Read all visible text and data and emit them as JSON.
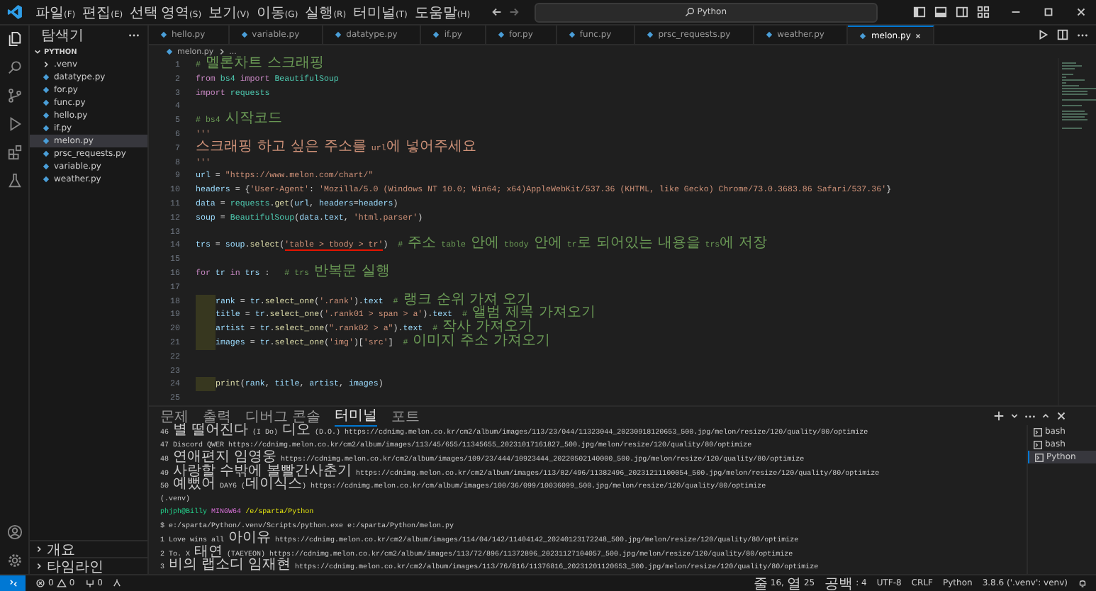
{
  "menu": [
    "파일(F)",
    "편집(E)",
    "선택 영역(S)",
    "보기(V)",
    "이동(G)",
    "실행(R)",
    "터미널(T)",
    "도움말(H)"
  ],
  "command_center": "Python",
  "explorer": {
    "title": "탐색기",
    "folder": "PYTHON",
    "items": [
      {
        "label": ".venv",
        "kind": "folder",
        "selected": false
      },
      {
        "label": "datatype.py",
        "kind": "file",
        "selected": false
      },
      {
        "label": "for.py",
        "kind": "file",
        "selected": false
      },
      {
        "label": "func.py",
        "kind": "file",
        "selected": false
      },
      {
        "label": "hello.py",
        "kind": "file",
        "selected": false
      },
      {
        "label": "if.py",
        "kind": "file",
        "selected": false
      },
      {
        "label": "melon.py",
        "kind": "file",
        "selected": true
      },
      {
        "label": "prsc_requests.py",
        "kind": "file",
        "selected": false
      },
      {
        "label": "variable.py",
        "kind": "file",
        "selected": false
      },
      {
        "label": "weather.py",
        "kind": "file",
        "selected": false
      }
    ],
    "sections": [
      "개요",
      "타임라인"
    ]
  },
  "tabs": [
    {
      "label": "hello.py",
      "selected": false
    },
    {
      "label": "variable.py",
      "selected": false
    },
    {
      "label": "datatype.py",
      "selected": false
    },
    {
      "label": "if.py",
      "selected": false
    },
    {
      "label": "for.py",
      "selected": false
    },
    {
      "label": "func.py",
      "selected": false
    },
    {
      "label": "prsc_requests.py",
      "selected": false
    },
    {
      "label": "weather.py",
      "selected": false
    },
    {
      "label": "melon.py",
      "selected": true
    }
  ],
  "breadcrumb": [
    "melon.py",
    "..."
  ],
  "code": [
    {
      "n": "1",
      "indented": false,
      "segs": [
        {
          "kind": "c",
          "text": "# 멜론차트 스크래핑"
        }
      ]
    },
    {
      "n": "2",
      "indented": false,
      "segs": [
        {
          "kind": "k",
          "text": "from "
        },
        {
          "kind": "t",
          "text": "bs4 "
        },
        {
          "kind": "k",
          "text": "import "
        },
        {
          "kind": "t",
          "text": "BeautifulSoup"
        }
      ]
    },
    {
      "n": "3",
      "indented": false,
      "segs": [
        {
          "kind": "k",
          "text": "import "
        },
        {
          "kind": "t",
          "text": "requests"
        }
      ]
    },
    {
      "n": "4",
      "indented": false
    },
    {
      "n": "5",
      "indented": false,
      "segs": [
        {
          "kind": "c",
          "text": "# bs4 시작코드"
        }
      ]
    },
    {
      "n": "6",
      "indented": false,
      "segs": [
        {
          "kind": "s",
          "text": "'''"
        }
      ]
    },
    {
      "n": "7",
      "indented": false,
      "segs": [
        {
          "kind": "s",
          "text": "스크래핑 하고 싶은 주소를 url에 넣어주세요"
        }
      ]
    },
    {
      "n": "8",
      "indented": false,
      "segs": [
        {
          "kind": "s",
          "text": "'''"
        }
      ]
    },
    {
      "n": "9",
      "indented": false,
      "segs": [
        {
          "kind": "v",
          "text": "url"
        },
        {
          "kind": "p",
          "text": " = "
        },
        {
          "kind": "s",
          "text": "\"https://www.melon.com/chart/\""
        }
      ]
    },
    {
      "n": "10",
      "indented": false,
      "segs": [
        {
          "kind": "v",
          "text": "headers"
        },
        {
          "kind": "p",
          "text": " = {"
        },
        {
          "kind": "s",
          "text": "'User-Agent'"
        },
        {
          "kind": "p",
          "text": ": "
        },
        {
          "kind": "s",
          "text": "'Mozilla/5.0 (Windows NT 10.0; Win64; x64)AppleWebKit/537.36 (KHTML, like Gecko) Chrome/73.0.3683.86 Safari/537.36'"
        },
        {
          "kind": "p",
          "text": "}"
        }
      ]
    },
    {
      "n": "11",
      "indented": false,
      "segs": [
        {
          "kind": "v",
          "text": "data"
        },
        {
          "kind": "p",
          "text": " = "
        },
        {
          "kind": "t",
          "text": "requests"
        },
        {
          "kind": "p",
          "text": "."
        },
        {
          "kind": "f",
          "text": "get"
        },
        {
          "kind": "p",
          "text": "("
        },
        {
          "kind": "v",
          "text": "url"
        },
        {
          "kind": "p",
          "text": ", "
        },
        {
          "kind": "v",
          "text": "headers"
        },
        {
          "kind": "p",
          "text": "="
        },
        {
          "kind": "v",
          "text": "headers"
        },
        {
          "kind": "p",
          "text": ")"
        }
      ]
    },
    {
      "n": "12",
      "indented": false,
      "segs": [
        {
          "kind": "v",
          "text": "soup"
        },
        {
          "kind": "p",
          "text": " = "
        },
        {
          "kind": "t",
          "text": "BeautifulSoup"
        },
        {
          "kind": "p",
          "text": "("
        },
        {
          "kind": "v",
          "text": "data"
        },
        {
          "kind": "p",
          "text": "."
        },
        {
          "kind": "v",
          "text": "text"
        },
        {
          "kind": "p",
          "text": ", "
        },
        {
          "kind": "s",
          "text": "'html.parser'"
        },
        {
          "kind": "p",
          "text": ")"
        }
      ]
    },
    {
      "n": "13",
      "indented": false
    },
    {
      "n": "14",
      "indented": false,
      "segs": [
        {
          "kind": "v",
          "text": "trs"
        },
        {
          "kind": "p",
          "text": " = "
        },
        {
          "kind": "v",
          "text": "soup"
        },
        {
          "kind": "p",
          "text": "."
        },
        {
          "kind": "f",
          "text": "select"
        },
        {
          "kind": "p",
          "text": "("
        },
        {
          "kind": "m",
          "text": "'table > tbody > tr'"
        },
        {
          "kind": "p",
          "text": ")"
        },
        {
          "kind": "c",
          "text": "  # 주소 table 안에 tbody 안에 tr로 되어있는 내용을 trs에 저장"
        }
      ]
    },
    {
      "n": "15",
      "indented": false
    },
    {
      "n": "16",
      "indented": false,
      "segs": [
        {
          "kind": "k",
          "text": "for "
        },
        {
          "kind": "v",
          "text": "tr "
        },
        {
          "kind": "k",
          "text": "in "
        },
        {
          "kind": "v",
          "text": "trs"
        },
        {
          "kind": "p",
          "text": " :"
        },
        {
          "kind": "c",
          "text": "   # trs 반복문 실행"
        }
      ]
    },
    {
      "n": "17",
      "indented": false
    },
    {
      "n": "18",
      "indented": true,
      "segs": [
        {
          "kind": "v",
          "text": "rank"
        },
        {
          "kind": "p",
          "text": " = "
        },
        {
          "kind": "v",
          "text": "tr"
        },
        {
          "kind": "p",
          "text": "."
        },
        {
          "kind": "f",
          "text": "select_one"
        },
        {
          "kind": "p",
          "text": "("
        },
        {
          "kind": "s",
          "text": "'.rank'"
        },
        {
          "kind": "p",
          "text": ")."
        },
        {
          "kind": "v",
          "text": "text"
        },
        {
          "kind": "c",
          "text": "  # 랭크 순위 가져 오기"
        }
      ]
    },
    {
      "n": "19",
      "indented": true,
      "segs": [
        {
          "kind": "v",
          "text": "title"
        },
        {
          "kind": "p",
          "text": " = "
        },
        {
          "kind": "v",
          "text": "tr"
        },
        {
          "kind": "p",
          "text": "."
        },
        {
          "kind": "f",
          "text": "select_one"
        },
        {
          "kind": "p",
          "text": "("
        },
        {
          "kind": "s",
          "text": "'.rank01 > span > a'"
        },
        {
          "kind": "p",
          "text": ")."
        },
        {
          "kind": "v",
          "text": "text"
        },
        {
          "kind": "c",
          "text": "  # 앨범 제목 가져오기"
        }
      ]
    },
    {
      "n": "20",
      "indented": true,
      "segs": [
        {
          "kind": "v",
          "text": "artist"
        },
        {
          "kind": "p",
          "text": " = "
        },
        {
          "kind": "v",
          "text": "tr"
        },
        {
          "kind": "p",
          "text": "."
        },
        {
          "kind": "f",
          "text": "select_one"
        },
        {
          "kind": "p",
          "text": "("
        },
        {
          "kind": "s",
          "text": "\".rank02 > a\""
        },
        {
          "kind": "p",
          "text": ")."
        },
        {
          "kind": "v",
          "text": "text"
        },
        {
          "kind": "c",
          "text": "  # 작사 가져오기"
        }
      ]
    },
    {
      "n": "21",
      "indented": true,
      "segs": [
        {
          "kind": "v",
          "text": "images"
        },
        {
          "kind": "p",
          "text": " = "
        },
        {
          "kind": "v",
          "text": "tr"
        },
        {
          "kind": "p",
          "text": "."
        },
        {
          "kind": "f",
          "text": "select_one"
        },
        {
          "kind": "p",
          "text": "("
        },
        {
          "kind": "s",
          "text": "'img'"
        },
        {
          "kind": "p",
          "text": ")["
        },
        {
          "kind": "s",
          "text": "'src'"
        },
        {
          "kind": "p",
          "text": "]"
        },
        {
          "kind": "c",
          "text": "  # 이미지 주소 가져오기"
        }
      ]
    },
    {
      "n": "22",
      "indented": false
    },
    {
      "n": "23",
      "indented": false
    },
    {
      "n": "24",
      "indented": true,
      "segs": [
        {
          "kind": "f",
          "text": "print"
        },
        {
          "kind": "p",
          "text": "("
        },
        {
          "kind": "v",
          "text": "rank"
        },
        {
          "kind": "p",
          "text": ", "
        },
        {
          "kind": "v",
          "text": "title"
        },
        {
          "kind": "p",
          "text": ", "
        },
        {
          "kind": "v",
          "text": "artist"
        },
        {
          "kind": "p",
          "text": ", "
        },
        {
          "kind": "v",
          "text": "images"
        },
        {
          "kind": "p",
          "text": ")"
        }
      ]
    },
    {
      "n": "25",
      "indented": false
    }
  ],
  "panel_tabs": [
    {
      "label": "문제",
      "selected": false
    },
    {
      "label": "출력",
      "selected": false
    },
    {
      "label": "디버그 콘솔",
      "selected": false
    },
    {
      "label": "터미널",
      "selected": true
    },
    {
      "label": "포트",
      "selected": false
    }
  ],
  "terminal": [
    {
      "kind": "out",
      "text": "46 별 떨어진다 (I Do) 디오 (D.O.) https://cdnimg.melon.co.kr/cm2/album/images/113/23/044/11323044_20230918120653_500.jpg/melon/resize/120/quality/80/optimize"
    },
    {
      "kind": "out",
      "text": "47 Discord QWER https://cdnimg.melon.co.kr/cm2/album/images/113/45/655/11345655_20231017161827_500.jpg/melon/resize/120/quality/80/optimize"
    },
    {
      "kind": "out",
      "text": "48 연애편지 임영웅 https://cdnimg.melon.co.kr/cm2/album/images/109/23/444/10923444_20220502140000_500.jpg/melon/resize/120/quality/80/optimize"
    },
    {
      "kind": "out",
      "text": "49 사랑할 수밖에 볼빨간사춘기 https://cdnimg.melon.co.kr/cm2/album/images/113/82/496/11382496_20231211100054_500.jpg/melon/resize/120/quality/80/optimize"
    },
    {
      "kind": "out",
      "text": "50 예뻤어 DAY6 (데이식스) https://cdnimg.melon.co.kr/cm/album/images/100/36/099/10036099_500.jpg/melon/resize/120/quality/80/optimize"
    },
    {
      "kind": "out",
      "text": "(.venv)"
    },
    {
      "kind": "prompt",
      "user": "phjph@Billy",
      "shell": "MINGW64",
      "path": "/e/sparta/Python"
    },
    {
      "kind": "out",
      "text": "$ e:/sparta/Python/.venv/Scripts/python.exe e:/sparta/Python/melon.py"
    },
    {
      "kind": "out",
      "text": "1 Love wins all 아이유 https://cdnimg.melon.co.kr/cm2/album/images/114/04/142/11404142_20240123172248_500.jpg/melon/resize/120/quality/80/optimize"
    },
    {
      "kind": "out",
      "text": "2 To. X 태연 (TAEYEON) https://cdnimg.melon.co.kr/cm2/album/images/113/72/896/11372896_20231127104057_500.jpg/melon/resize/120/quality/80/optimize"
    },
    {
      "kind": "out",
      "text": "3 비의 랩소디 임재현 https://cdnimg.melon.co.kr/cm2/album/images/113/76/816/11376816_20231201120653_500.jpg/melon/resize/120/quality/80/optimize"
    }
  ],
  "terminals": [
    {
      "label": "bash",
      "selected": false
    },
    {
      "label": "bash",
      "selected": false
    },
    {
      "label": "Python",
      "selected": true
    }
  ],
  "status_bar": {
    "errors": "0",
    "warnings": "0",
    "ports": "0",
    "right": [
      "줄 16, 열 25",
      "공백: 4",
      "UTF-8",
      "CRLF",
      "Python",
      "3.8.6 ('.venv': venv)"
    ]
  }
}
